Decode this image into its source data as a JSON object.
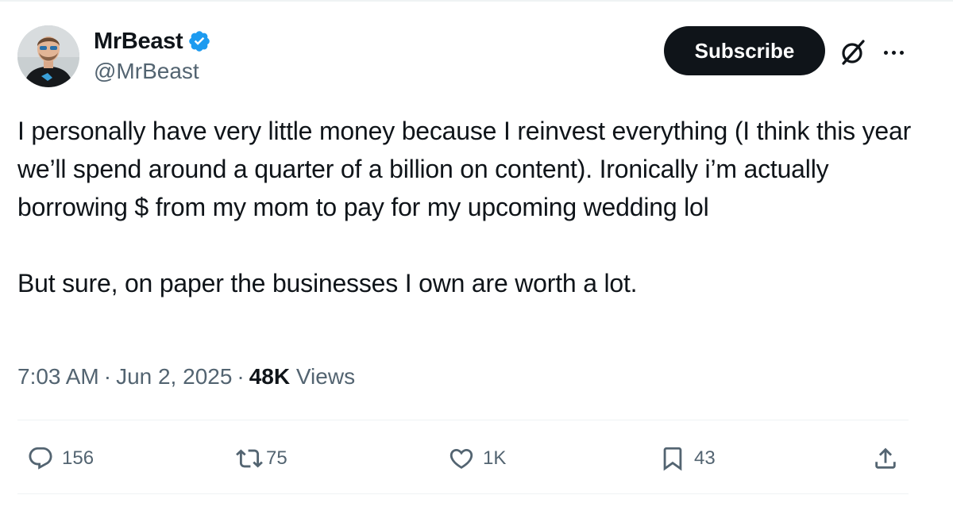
{
  "author": {
    "display_name": "MrBeast",
    "handle": "@MrBeast",
    "verified": true
  },
  "header": {
    "subscribe_label": "Subscribe",
    "grok_icon": "grok-icon",
    "more_icon": "more-options-icon"
  },
  "tweet": {
    "paragraphs": [
      "I personally have very little money because I reinvest everything (I think this year we’ll spend around a quarter of a billion on content). Ironically i’m actually borrowing $ from my mom to pay for my upcoming wedding lol",
      "But sure, on paper the businesses I own are worth a lot."
    ]
  },
  "meta": {
    "time": "7:03 AM",
    "separator": "·",
    "date": "Jun 2, 2025",
    "views_count": "48K",
    "views_label": "Views"
  },
  "actions": {
    "replies": "156",
    "reposts": "75",
    "likes": "1K",
    "bookmarks": "43"
  },
  "colors": {
    "text_primary": "#0f1419",
    "text_secondary": "#536471",
    "verified_blue": "#1d9bf0",
    "divider": "#eff3f4",
    "button_bg": "#0f1419"
  }
}
